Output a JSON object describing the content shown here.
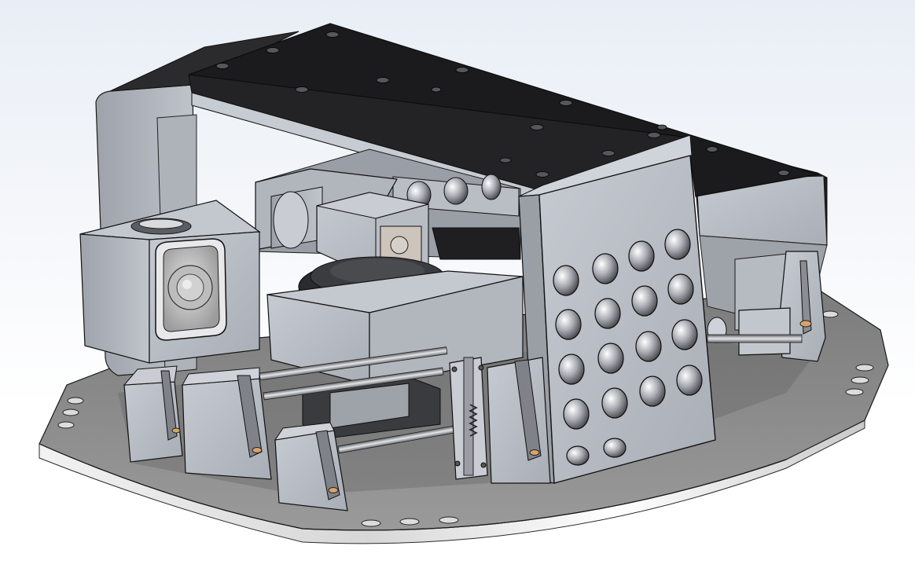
{
  "scene": {
    "subject": "cad-assembly-render",
    "background_top_color": "#e6ebf4",
    "background_bottom_color": "#ffffff",
    "colors": {
      "base_plate": "#8c8c8c",
      "base_plate_edge": "#d8d8d8",
      "body_gray": "#b4b8c0",
      "body_gray_dark": "#8e939c",
      "top_plate": "#1c1c1e",
      "outline": "#141414",
      "lens_glass": "#c9c9c9",
      "rod_steel": "#9c9ea2"
    },
    "counts": {
      "ventilation_holes": 18,
      "top_plate_screws": 16,
      "clamp_blocks": 5,
      "base_plate_holes": 10
    }
  }
}
